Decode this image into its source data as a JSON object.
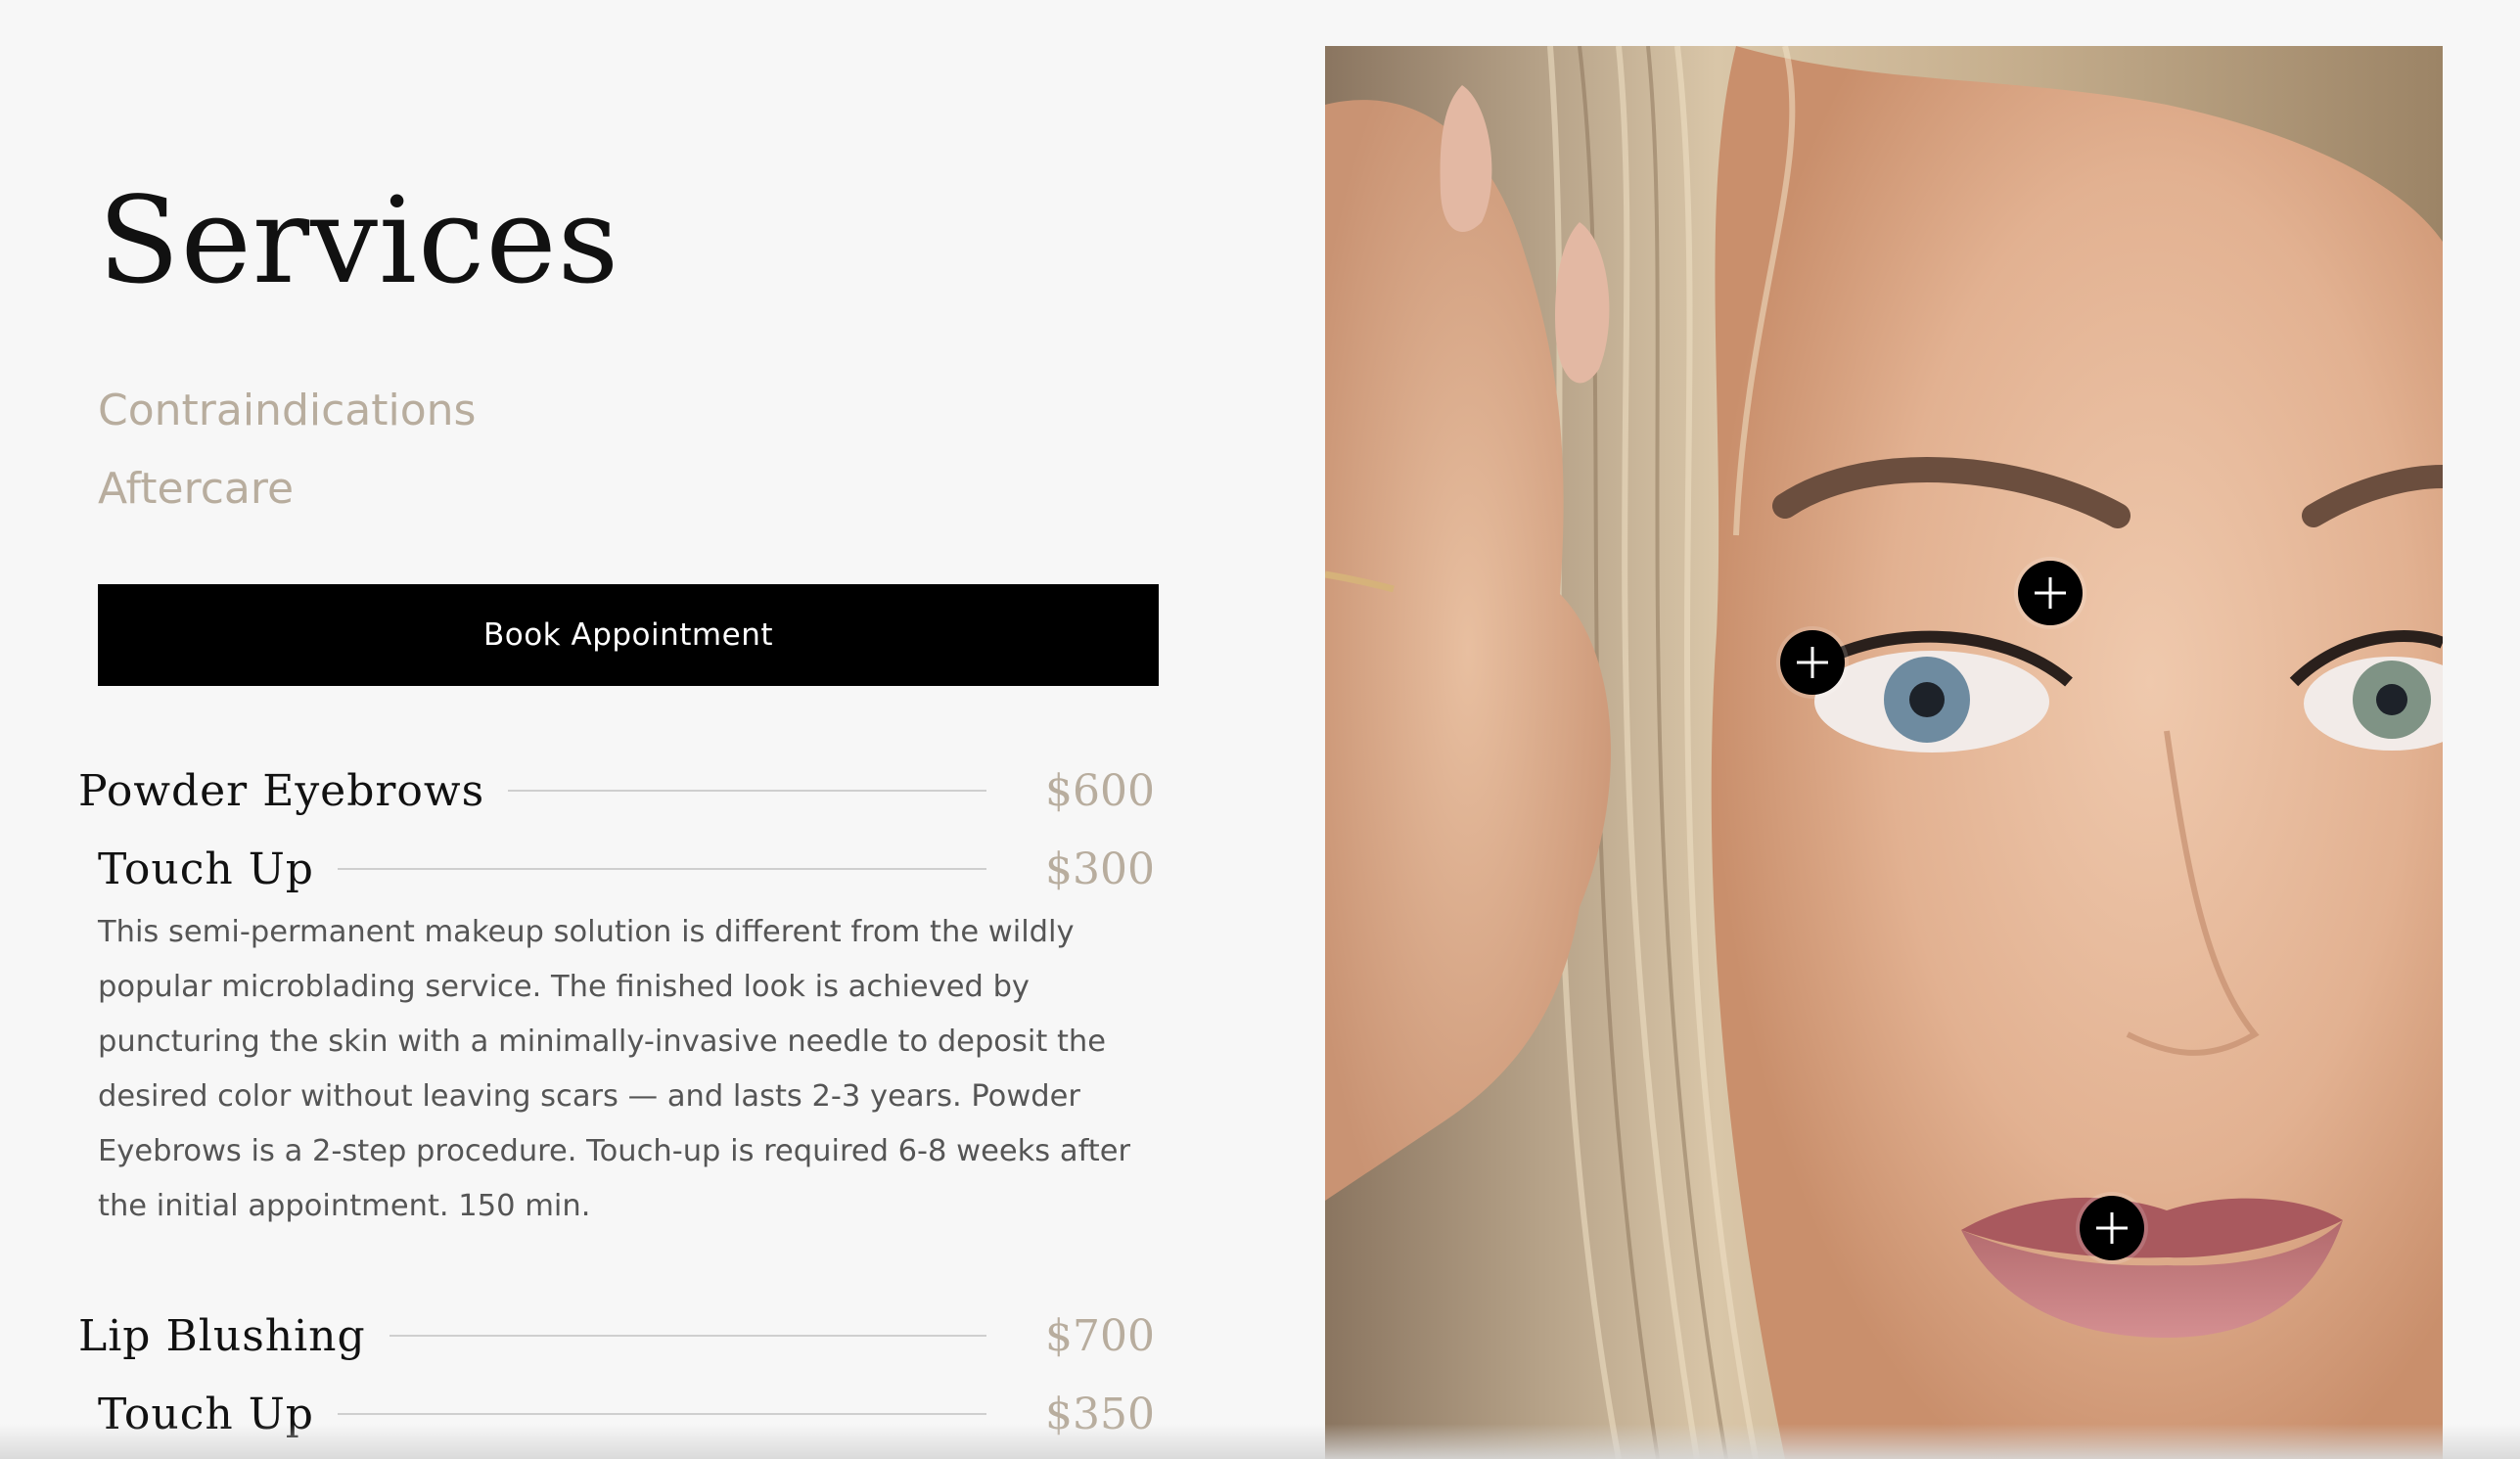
{
  "page": {
    "title": "Services",
    "links": [
      {
        "label": "Contraindications"
      },
      {
        "label": "Aftercare"
      }
    ],
    "book_button": "Book Appointment"
  },
  "services": [
    {
      "name": "Powder Eyebrows",
      "price": "$600",
      "touch_up": {
        "name": "Touch Up",
        "price": "$300"
      },
      "description": "This semi-permanent makeup solution is different from the wildly popular microblading service. The finished look is achieved by puncturing the skin with a minimally-invasive needle to deposit the desired color without leaving scars — and lasts 2-3 years. Powder Eyebrows is a 2-step procedure. Touch-up is required 6-8 weeks after the initial appointment. 150 min."
    },
    {
      "name": "Lip Blushing",
      "price": "$700",
      "touch_up": {
        "name": "Touch Up",
        "price": "$350"
      }
    }
  ],
  "hotspots": [
    {
      "icon": "plus-icon",
      "target": "eyebrow"
    },
    {
      "icon": "plus-icon",
      "target": "eyeliner"
    },
    {
      "icon": "plus-icon",
      "target": "lips"
    }
  ],
  "colors": {
    "background": "#f7f7f7",
    "accent": "#b8ad9e",
    "button": "#000000",
    "text": "#111111",
    "body_text": "#555555"
  }
}
